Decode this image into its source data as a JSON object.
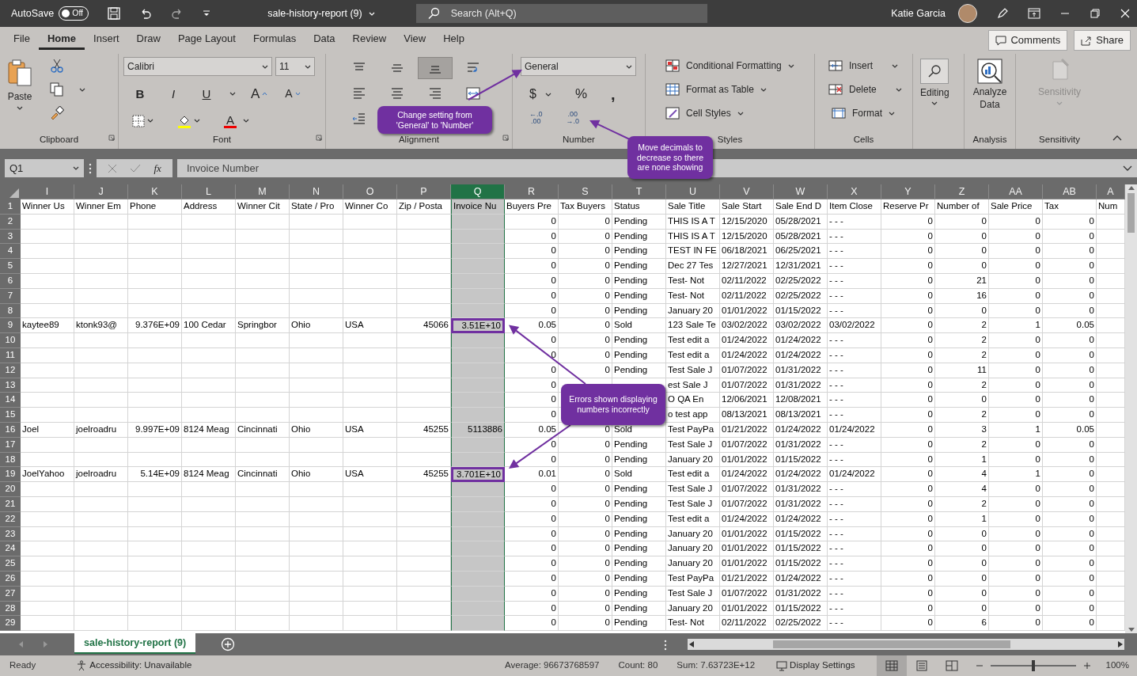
{
  "title_bar": {
    "autosave_label": "AutoSave",
    "autosave": {
      "on": false,
      "label": "Off"
    },
    "file_title": "sale-history-report (9)",
    "search": {
      "placeholder": "Search (Alt+Q)"
    },
    "user_name": "Katie Garcia"
  },
  "ribbon_tabs": [
    {
      "label": "File",
      "selected": false
    },
    {
      "label": "Home",
      "selected": true
    },
    {
      "label": "Insert",
      "selected": false
    },
    {
      "label": "Draw",
      "selected": false
    },
    {
      "label": "Page Layout",
      "selected": false
    },
    {
      "label": "Formulas",
      "selected": false
    },
    {
      "label": "Data",
      "selected": false
    },
    {
      "label": "Review",
      "selected": false
    },
    {
      "label": "View",
      "selected": false
    },
    {
      "label": "Help",
      "selected": false
    }
  ],
  "ribbon_actions": [
    "Comments",
    "Share"
  ],
  "ribbon": {
    "clipboard": {
      "paste": "Paste",
      "label": "Clipboard"
    },
    "font": {
      "name": "Calibri",
      "size": "11",
      "style_buttons": [
        "B",
        "I",
        "U"
      ],
      "grow": "A",
      "shrink": "A",
      "font_color": "A",
      "label": "Font"
    },
    "alignment": {
      "label": "Alignment",
      "buttons": [
        {
          "selected": false
        },
        {
          "selected": false
        },
        {
          "selected": true
        },
        {
          "selected": false
        },
        {
          "selected": false
        },
        {
          "selected": false
        },
        {
          "selected": false
        },
        {
          "selected": false
        },
        {
          "selected": false
        }
      ]
    },
    "number": {
      "format": "General",
      "currency": "$",
      "percent": "%",
      "comma": ",",
      "decimal_buttons": [
        {
          "upper": "←.0",
          "lower": ".00"
        },
        {
          "upper": ".00",
          "lower": "→.0"
        }
      ],
      "label": "Number"
    },
    "styles": {
      "buttons": [
        "Conditional Formatting",
        "Format as Table",
        "Cell Styles"
      ],
      "label": "Styles"
    },
    "cells": {
      "buttons": [
        "Insert",
        "Delete",
        "Format"
      ],
      "label": "Cells"
    },
    "editing": {
      "button": "Editing"
    },
    "analysis": {
      "button": "Analyze Data",
      "label": "Analysis"
    },
    "sensitivity": {
      "button": "Sensitivity",
      "label": "Sensitivity",
      "disabled": true
    }
  },
  "formula_bar": {
    "name_box": "Q1",
    "fx": "fx",
    "formula": "Invoice Number"
  },
  "table": {
    "columns": [
      {
        "letter": "I",
        "header": "Winner Us",
        "numeric": false,
        "selected": false
      },
      {
        "letter": "J",
        "header": "Winner Em",
        "numeric": false,
        "selected": false
      },
      {
        "letter": "K",
        "header": "Phone",
        "numeric": true,
        "selected": false
      },
      {
        "letter": "L",
        "header": "Address",
        "numeric": false,
        "selected": false
      },
      {
        "letter": "M",
        "header": "Winner Cit",
        "numeric": false,
        "selected": false
      },
      {
        "letter": "N",
        "header": "State / Pro",
        "numeric": false,
        "selected": false
      },
      {
        "letter": "O",
        "header": "Winner Co",
        "numeric": false,
        "selected": false
      },
      {
        "letter": "P",
        "header": "Zip / Posta",
        "numeric": true,
        "selected": false
      },
      {
        "letter": "Q",
        "header": "Invoice Nu",
        "numeric": true,
        "selected": true
      },
      {
        "letter": "R",
        "header": "Buyers Pre",
        "numeric": true,
        "selected": false
      },
      {
        "letter": "S",
        "header": "Tax Buyers",
        "numeric": true,
        "selected": false
      },
      {
        "letter": "T",
        "header": "Status",
        "numeric": false,
        "selected": false
      },
      {
        "letter": "U",
        "header": "Sale Title",
        "numeric": false,
        "selected": false
      },
      {
        "letter": "V",
        "header": "Sale Start",
        "numeric": false,
        "selected": false
      },
      {
        "letter": "W",
        "header": "Sale End D",
        "numeric": false,
        "selected": false
      },
      {
        "letter": "X",
        "header": "Item Close",
        "numeric": false,
        "selected": false
      },
      {
        "letter": "Y",
        "header": "Reserve Pr",
        "numeric": true,
        "selected": false
      },
      {
        "letter": "Z",
        "header": "Number of",
        "numeric": true,
        "selected": false
      },
      {
        "letter": "AA",
        "header": "Sale Price",
        "numeric": true,
        "selected": false
      },
      {
        "letter": "AB",
        "header": "Tax",
        "numeric": true,
        "selected": false
      },
      {
        "letter": "A",
        "header": "Num",
        "selected": false
      }
    ],
    "header_row_number": "1",
    "rows": [
      {
        "number": "2",
        "flagged": false,
        "cells": [
          null,
          null,
          null,
          null,
          null,
          null,
          null,
          null,
          null,
          "0",
          "0",
          "Pending",
          "THIS IS A T",
          "12/15/2020",
          "05/28/2021",
          "- - -",
          "0",
          "0",
          "0",
          "0",
          null
        ]
      },
      {
        "number": "3",
        "flagged": false,
        "cells": [
          null,
          null,
          null,
          null,
          null,
          null,
          null,
          null,
          null,
          "0",
          "0",
          "Pending",
          "THIS IS A T",
          "12/15/2020",
          "05/28/2021",
          "- - -",
          "0",
          "0",
          "0",
          "0",
          null
        ]
      },
      {
        "number": "4",
        "flagged": false,
        "cells": [
          null,
          null,
          null,
          null,
          null,
          null,
          null,
          null,
          null,
          "0",
          "0",
          "Pending",
          "TEST IN FE",
          "06/18/2021",
          "06/25/2021",
          "- - -",
          "0",
          "0",
          "0",
          "0",
          null
        ]
      },
      {
        "number": "5",
        "flagged": false,
        "cells": [
          null,
          null,
          null,
          null,
          null,
          null,
          null,
          null,
          null,
          "0",
          "0",
          "Pending",
          "Dec 27 Tes",
          "12/27/2021",
          "12/31/2021",
          "- - -",
          "0",
          "0",
          "0",
          "0",
          null
        ]
      },
      {
        "number": "6",
        "flagged": false,
        "cells": [
          null,
          null,
          null,
          null,
          null,
          null,
          null,
          null,
          null,
          "0",
          "0",
          "Pending",
          "Test- Not",
          "02/11/2022",
          "02/25/2022",
          "- - -",
          "0",
          "21",
          "0",
          "0",
          null
        ]
      },
      {
        "number": "7",
        "flagged": false,
        "cells": [
          null,
          null,
          null,
          null,
          null,
          null,
          null,
          null,
          null,
          "0",
          "0",
          "Pending",
          "Test- Not",
          "02/11/2022",
          "02/25/2022",
          "- - -",
          "0",
          "16",
          "0",
          "0",
          null
        ]
      },
      {
        "number": "8",
        "flagged": false,
        "cells": [
          null,
          null,
          null,
          null,
          null,
          null,
          null,
          null,
          null,
          "0",
          "0",
          "Pending",
          "January 20",
          "01/01/2022",
          "01/15/2022",
          "- - -",
          "0",
          "0",
          "0",
          "0",
          null
        ]
      },
      {
        "number": "9",
        "flagged": true,
        "cells": [
          "kaytee89",
          "ktonk93@",
          "9.376E+09",
          "100 Cedar",
          "Springbor",
          "Ohio",
          "USA",
          "45066",
          "3.51E+10",
          "0.05",
          "0",
          "Sold",
          "123 Sale Te",
          "03/02/2022",
          "03/02/2022",
          "03/02/2022",
          "0",
          "2",
          "1",
          "0.05",
          null
        ]
      },
      {
        "number": "10",
        "flagged": false,
        "cells": [
          null,
          null,
          null,
          null,
          null,
          null,
          null,
          null,
          null,
          "0",
          "0",
          "Pending",
          "Test edit a",
          "01/24/2022",
          "01/24/2022",
          "- - -",
          "0",
          "2",
          "0",
          "0",
          null
        ]
      },
      {
        "number": "11",
        "flagged": false,
        "cells": [
          null,
          null,
          null,
          null,
          null,
          null,
          null,
          null,
          null,
          "0",
          "0",
          "Pending",
          "Test edit a",
          "01/24/2022",
          "01/24/2022",
          "- - -",
          "0",
          "2",
          "0",
          "0",
          null
        ]
      },
      {
        "number": "12",
        "flagged": false,
        "cells": [
          null,
          null,
          null,
          null,
          null,
          null,
          null,
          null,
          null,
          "0",
          "0",
          "Pending",
          "Test Sale J",
          "01/07/2022",
          "01/31/2022",
          "- - -",
          "0",
          "11",
          "0",
          "0",
          null
        ]
      },
      {
        "number": "13",
        "flagged": false,
        "cells": [
          null,
          null,
          null,
          null,
          null,
          null,
          null,
          null,
          null,
          "0",
          null,
          null,
          "est Sale J",
          "01/07/2022",
          "01/31/2022",
          "- - -",
          "0",
          "2",
          "0",
          "0",
          null
        ]
      },
      {
        "number": "14",
        "flagged": false,
        "cells": [
          null,
          null,
          null,
          null,
          null,
          null,
          null,
          null,
          null,
          "0",
          null,
          null,
          "O QA En",
          "12/06/2021",
          "12/08/2021",
          "- - -",
          "0",
          "0",
          "0",
          "0",
          null
        ]
      },
      {
        "number": "15",
        "flagged": false,
        "cells": [
          null,
          null,
          null,
          null,
          null,
          null,
          null,
          null,
          null,
          "0",
          null,
          null,
          "o test app",
          "08/13/2021",
          "08/13/2021",
          "- - -",
          "0",
          "2",
          "0",
          "0",
          null
        ]
      },
      {
        "number": "16",
        "flagged": false,
        "cells": [
          "Joel",
          "joelroadru",
          "9.997E+09",
          "8124 Meag",
          "Cincinnati",
          "Ohio",
          "USA",
          "45255",
          "5113886",
          "0.05",
          "0",
          "Sold",
          "Test PayPa",
          "01/21/2022",
          "01/24/2022",
          "01/24/2022",
          "0",
          "3",
          "1",
          "0.05",
          null
        ]
      },
      {
        "number": "17",
        "flagged": false,
        "cells": [
          null,
          null,
          null,
          null,
          null,
          null,
          null,
          null,
          null,
          "0",
          "0",
          "Pending",
          "Test Sale J",
          "01/07/2022",
          "01/31/2022",
          "- - -",
          "0",
          "2",
          "0",
          "0",
          null
        ]
      },
      {
        "number": "18",
        "flagged": false,
        "cells": [
          null,
          null,
          null,
          null,
          null,
          null,
          null,
          null,
          null,
          "0",
          "0",
          "Pending",
          "January 20",
          "01/01/2022",
          "01/15/2022",
          "- - -",
          "0",
          "1",
          "0",
          "0",
          null
        ]
      },
      {
        "number": "19",
        "flagged": true,
        "cells": [
          "JoelYahoo",
          "joelroadru",
          "5.14E+09",
          "8124 Meag",
          "Cincinnati",
          "Ohio",
          "USA",
          "45255",
          "3.701E+10",
          "0.01",
          "0",
          "Sold",
          "Test edit a",
          "01/24/2022",
          "01/24/2022",
          "01/24/2022",
          "0",
          "4",
          "1",
          "0",
          null
        ]
      },
      {
        "number": "20",
        "flagged": false,
        "cells": [
          null,
          null,
          null,
          null,
          null,
          null,
          null,
          null,
          null,
          "0",
          "0",
          "Pending",
          "Test Sale J",
          "01/07/2022",
          "01/31/2022",
          "- - -",
          "0",
          "4",
          "0",
          "0",
          null
        ]
      },
      {
        "number": "21",
        "flagged": false,
        "cells": [
          null,
          null,
          null,
          null,
          null,
          null,
          null,
          null,
          null,
          "0",
          "0",
          "Pending",
          "Test Sale J",
          "01/07/2022",
          "01/31/2022",
          "- - -",
          "0",
          "2",
          "0",
          "0",
          null
        ]
      },
      {
        "number": "22",
        "flagged": false,
        "cells": [
          null,
          null,
          null,
          null,
          null,
          null,
          null,
          null,
          null,
          "0",
          "0",
          "Pending",
          "Test edit a",
          "01/24/2022",
          "01/24/2022",
          "- - -",
          "0",
          "1",
          "0",
          "0",
          null
        ]
      },
      {
        "number": "23",
        "flagged": false,
        "cells": [
          null,
          null,
          null,
          null,
          null,
          null,
          null,
          null,
          null,
          "0",
          "0",
          "Pending",
          "January 20",
          "01/01/2022",
          "01/15/2022",
          "- - -",
          "0",
          "0",
          "0",
          "0",
          null
        ]
      },
      {
        "number": "24",
        "flagged": false,
        "cells": [
          null,
          null,
          null,
          null,
          null,
          null,
          null,
          null,
          null,
          "0",
          "0",
          "Pending",
          "January 20",
          "01/01/2022",
          "01/15/2022",
          "- - -",
          "0",
          "0",
          "0",
          "0",
          null
        ]
      },
      {
        "number": "25",
        "flagged": false,
        "cells": [
          null,
          null,
          null,
          null,
          null,
          null,
          null,
          null,
          null,
          "0",
          "0",
          "Pending",
          "January 20",
          "01/01/2022",
          "01/15/2022",
          "- - -",
          "0",
          "0",
          "0",
          "0",
          null
        ]
      },
      {
        "number": "26",
        "flagged": false,
        "cells": [
          null,
          null,
          null,
          null,
          null,
          null,
          null,
          null,
          null,
          "0",
          "0",
          "Pending",
          "Test PayPa",
          "01/21/2022",
          "01/24/2022",
          "- - -",
          "0",
          "0",
          "0",
          "0",
          null
        ]
      },
      {
        "number": "27",
        "flagged": false,
        "cells": [
          null,
          null,
          null,
          null,
          null,
          null,
          null,
          null,
          null,
          "0",
          "0",
          "Pending",
          "Test Sale J",
          "01/07/2022",
          "01/31/2022",
          "- - -",
          "0",
          "0",
          "0",
          "0",
          null
        ]
      },
      {
        "number": "28",
        "flagged": false,
        "cells": [
          null,
          null,
          null,
          null,
          null,
          null,
          null,
          null,
          null,
          "0",
          "0",
          "Pending",
          "January 20",
          "01/01/2022",
          "01/15/2022",
          "- - -",
          "0",
          "0",
          "0",
          "0",
          null
        ]
      },
      {
        "number": "29",
        "flagged": false,
        "cells": [
          null,
          null,
          null,
          null,
          null,
          null,
          null,
          null,
          null,
          "0",
          "0",
          "Pending",
          "Test- Not",
          "02/11/2022",
          "02/25/2022",
          "- - -",
          "0",
          "6",
          "0",
          "0",
          null
        ]
      }
    ]
  },
  "sheet_tabs": [
    {
      "label": "sale-history-report (9)",
      "selected": true
    }
  ],
  "status_bar": {
    "mode": "Ready",
    "accessibility": "Accessibility: Unavailable",
    "average": "Average: 96673768597",
    "count": "Count: 80",
    "sum": "Sum: 7.63723E+12",
    "display_settings": "Display Settings",
    "views": [
      {
        "selected": true
      },
      {
        "selected": false
      },
      {
        "selected": false
      }
    ],
    "zoom": {
      "level": 0.5,
      "reading": "100%"
    }
  },
  "callouts": [
    {
      "text": "Change setting from 'General' to 'Number'"
    },
    {
      "text": "Move decimals to decrease so there are none showing"
    },
    {
      "text": "Errors shown displaying numbers incorrectly"
    }
  ]
}
